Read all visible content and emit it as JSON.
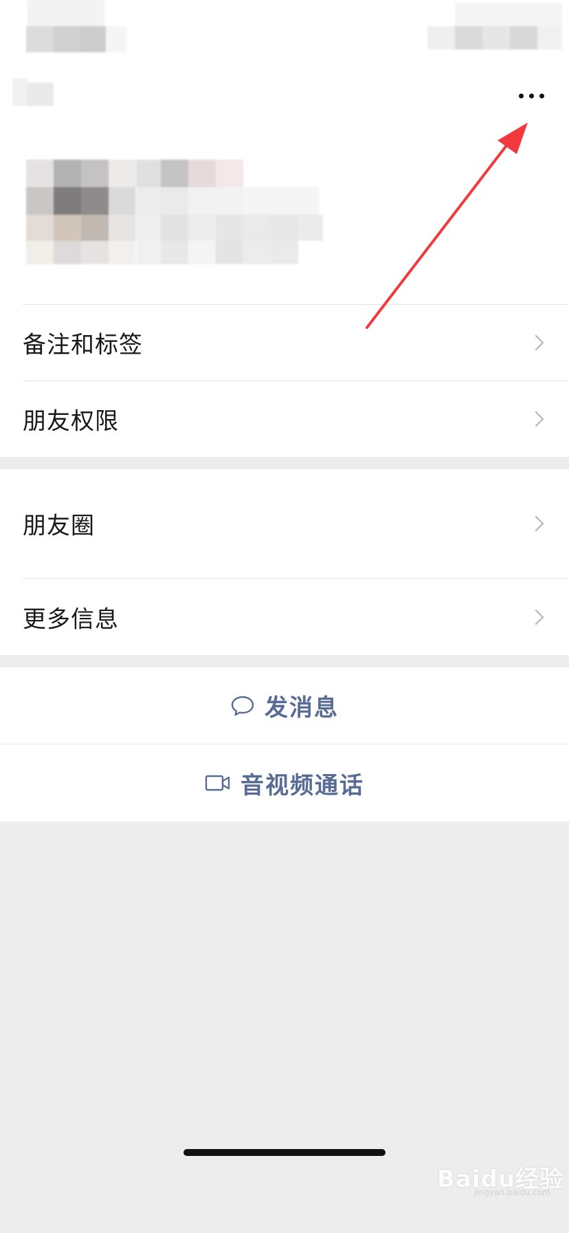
{
  "header": {
    "more_icon": "more-horizontal-icon"
  },
  "profile": {
    "rows": [
      {
        "label": "备注和标签",
        "icon": "chevron-right-icon"
      },
      {
        "label": "朋友权限",
        "icon": "chevron-right-icon"
      }
    ]
  },
  "moments_group": {
    "rows": [
      {
        "label": "朋友圈",
        "icon": "chevron-right-icon"
      },
      {
        "label": "更多信息",
        "icon": "chevron-right-icon"
      }
    ]
  },
  "actions": {
    "send_message": {
      "label": "发消息",
      "icon": "chat-bubble-icon"
    },
    "av_call": {
      "label": "音视频通话",
      "icon": "video-camera-icon"
    }
  },
  "watermark": {
    "text": "Baidu经验",
    "sub": "jingyan.baidu.com"
  },
  "colors": {
    "background": "#ededed",
    "cell": "#ffffff",
    "link": "#576b95",
    "annotation_arrow": "#f23a3e"
  }
}
